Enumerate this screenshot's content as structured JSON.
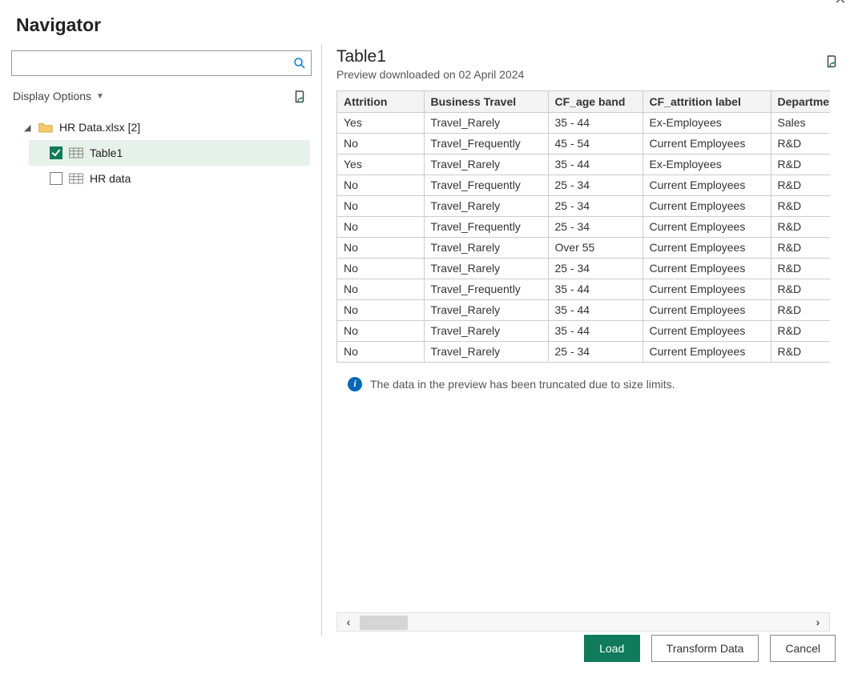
{
  "window": {
    "title": "Navigator"
  },
  "search": {
    "placeholder": ""
  },
  "display_options": {
    "label": "Display Options"
  },
  "tree": {
    "file_label": "HR Data.xlsx [2]",
    "items": [
      {
        "label": "Table1",
        "checked": true
      },
      {
        "label": "HR data",
        "checked": false
      }
    ]
  },
  "preview": {
    "title": "Table1",
    "subtitle": "Preview downloaded on 02 April 2024",
    "columns": [
      "Attrition",
      "Business Travel",
      "CF_age band",
      "CF_attrition label",
      "Departmen"
    ],
    "rows": [
      [
        "Yes",
        "Travel_Rarely",
        "35 - 44",
        "Ex-Employees",
        "Sales"
      ],
      [
        "No",
        "Travel_Frequently",
        "45 - 54",
        "Current Employees",
        "R&D"
      ],
      [
        "Yes",
        "Travel_Rarely",
        "35 - 44",
        "Ex-Employees",
        "R&D"
      ],
      [
        "No",
        "Travel_Frequently",
        "25 - 34",
        "Current Employees",
        "R&D"
      ],
      [
        "No",
        "Travel_Rarely",
        "25 - 34",
        "Current Employees",
        "R&D"
      ],
      [
        "No",
        "Travel_Frequently",
        "25 - 34",
        "Current Employees",
        "R&D"
      ],
      [
        "No",
        "Travel_Rarely",
        "Over 55",
        "Current Employees",
        "R&D"
      ],
      [
        "No",
        "Travel_Rarely",
        "25 - 34",
        "Current Employees",
        "R&D"
      ],
      [
        "No",
        "Travel_Frequently",
        "35 - 44",
        "Current Employees",
        "R&D"
      ],
      [
        "No",
        "Travel_Rarely",
        "35 - 44",
        "Current Employees",
        "R&D"
      ],
      [
        "No",
        "Travel_Rarely",
        "35 - 44",
        "Current Employees",
        "R&D"
      ],
      [
        "No",
        "Travel_Rarely",
        "25 - 34",
        "Current Employees",
        "R&D"
      ]
    ],
    "truncation_message": "The data in the preview has been truncated due to size limits."
  },
  "buttons": {
    "load": "Load",
    "transform": "Transform Data",
    "cancel": "Cancel"
  }
}
